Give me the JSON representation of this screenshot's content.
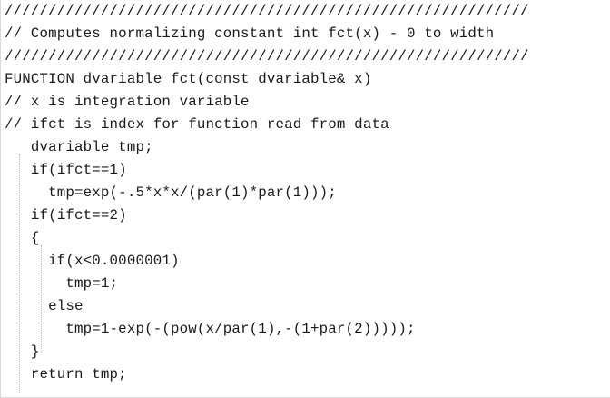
{
  "code": {
    "lines": [
      "////////////////////////////////////////////////////////////",
      "// Computes normalizing constant int fct(x) - 0 to width",
      "////////////////////////////////////////////////////////////",
      "FUNCTION dvariable fct(const dvariable& x)",
      "// x is integration variable",
      "// ifct is index for function read from data",
      "   dvariable tmp;",
      "   if(ifct==1)",
      "     tmp=exp(-.5*x*x/(par(1)*par(1)));",
      "   if(ifct==2)",
      "   {",
      "     if(x<0.0000001)",
      "       tmp=1;",
      "     else",
      "       tmp=1-exp(-(pow(x/par(1),-(1+par(2)))));",
      "   }",
      "   return tmp;"
    ]
  }
}
